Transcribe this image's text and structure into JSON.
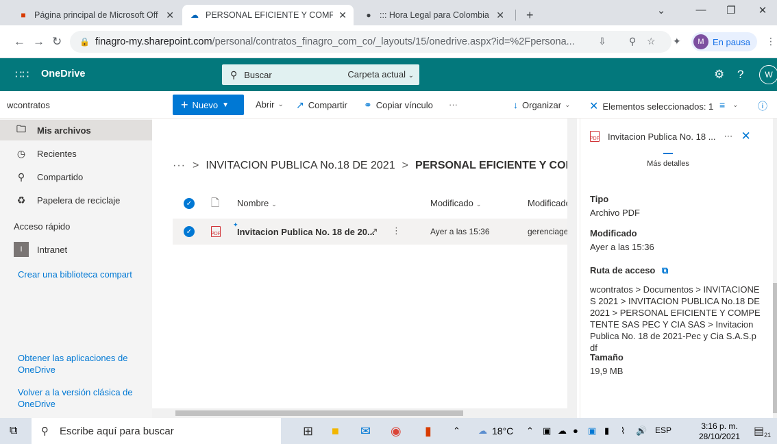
{
  "browser": {
    "tabs": [
      {
        "title": "Página principal de Microsoft Off",
        "active": false
      },
      {
        "title": "PERSONAL EFICIENTE Y COMPET",
        "active": true
      },
      {
        "title": "::: Hora Legal para Colombia :::",
        "active": false
      }
    ],
    "new_tab": "+",
    "url_domain": "finagro-my.sharepoint.com",
    "url_path": "/personal/contratos_finagro_com_co/_layouts/15/onedrive.aspx?id=%2Fpersona...",
    "profile_initial": "M",
    "profile_status": "En pausa"
  },
  "header": {
    "app_title": "OneDrive",
    "search_placeholder": "Buscar",
    "search_scope": "Carpeta actual",
    "user_initial": "W",
    "help": "?"
  },
  "command_bar": {
    "site_name": "wcontratos",
    "new_label": "Nuevo",
    "open_label": "Abrir",
    "share_label": "Compartir",
    "copy_link_label": "Copiar vínculo",
    "overflow": "···",
    "sort_label": "Organizar",
    "selected_label": "Elementos seleccionados: 1"
  },
  "leftnav": {
    "items": [
      {
        "label": "Mis archivos",
        "icon": "folder-icon",
        "selected": true
      },
      {
        "label": "Recientes",
        "icon": "clock-icon"
      },
      {
        "label": "Compartido",
        "icon": "people-icon"
      },
      {
        "label": "Papelera de reciclaje",
        "icon": "recycle-bin-icon"
      }
    ],
    "quick_access_title": "Acceso rápido",
    "quick_access_item": "Intranet",
    "quick_access_badge": "I",
    "create_library": "Crear una biblioteca compart",
    "get_apps": "Obtener las aplicaciones de OneDrive",
    "classic_view": "Volver a la versión clásica de OneDrive"
  },
  "main": {
    "breadcrumb_dots": "···",
    "breadcrumb_parent": "INVITACION PUBLICA No.18 DE 2021",
    "breadcrumb_current": "PERSONAL EFICIENTE Y COMPE",
    "columns": {
      "name": "Nombre",
      "modified": "Modificado",
      "modified_by": "Modificado"
    },
    "rows": [
      {
        "name": "Invitacion Publica No. 18 de 20...",
        "modified": "Ayer a las 15:36",
        "modified_by": "gerenciagen"
      }
    ]
  },
  "details": {
    "file_name": "Invitacion Publica No. 18 ...",
    "more_details": "Más detalles",
    "type_label": "Tipo",
    "type_value": "Archivo PDF",
    "modified_label": "Modificado",
    "modified_value": "Ayer a las 15:36",
    "path_label": "Ruta de acceso",
    "path_value": "wcontratos > Documentos > INVITACIONES 2021 > INVITACION PUBLICA No.18 DE 2021 > PERSONAL EFICIENTE Y COMPETENTE SAS PEC Y CIA SAS > Invitacion Publica No. 18 de 2021-Pec y Cia S.A.S.pdf",
    "size_label": "Tamaño",
    "size_value": "19,9 MB"
  },
  "taskbar": {
    "search_placeholder": "Escribe aquí para buscar",
    "weather": "18°C",
    "language": "ESP",
    "time": "3:16 p. m.",
    "date": "28/10/2021",
    "notification_count": "21"
  },
  "colors": {
    "onedrive_header": "#03787c",
    "accent": "#0078d4",
    "pdf_red": "#d13438"
  }
}
